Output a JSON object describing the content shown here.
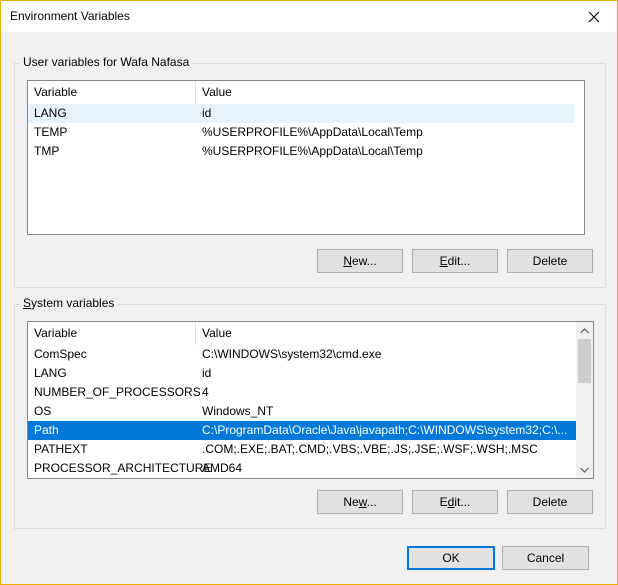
{
  "window": {
    "title": "Environment Variables",
    "accent_color": "#e8b100"
  },
  "user_section": {
    "label": "User variables for Wafa Nafasa",
    "columns": [
      "Variable",
      "Value"
    ],
    "rows": [
      {
        "variable": "LANG",
        "value": "id"
      },
      {
        "variable": "TEMP",
        "value": "%USERPROFILE%\\AppData\\Local\\Temp"
      },
      {
        "variable": "TMP",
        "value": "%USERPROFILE%\\AppData\\Local\\Temp"
      }
    ],
    "buttons": {
      "new": "New...",
      "edit": "Edit...",
      "delete": "Delete"
    }
  },
  "system_section": {
    "label": "System variables",
    "columns": [
      "Variable",
      "Value"
    ],
    "rows": [
      {
        "variable": "ComSpec",
        "value": "C:\\WINDOWS\\system32\\cmd.exe"
      },
      {
        "variable": "LANG",
        "value": "id"
      },
      {
        "variable": "NUMBER_OF_PROCESSORS",
        "value": "4"
      },
      {
        "variable": "OS",
        "value": "Windows_NT"
      },
      {
        "variable": "Path",
        "value": "C:\\ProgramData\\Oracle\\Java\\javapath;C:\\WINDOWS\\system32;C:\\..."
      },
      {
        "variable": "PATHEXT",
        "value": ".COM;.EXE;.BAT;.CMD;.VBS;.VBE;.JS;.JSE;.WSF;.WSH;.MSC"
      },
      {
        "variable": "PROCESSOR_ARCHITECTURE",
        "value": "AMD64"
      }
    ],
    "selected_variable": "Path",
    "buttons": {
      "new": "New...",
      "edit": "Edit...",
      "delete": "Delete"
    }
  },
  "footer": {
    "ok": "OK",
    "cancel": "Cancel"
  },
  "icons": {
    "close": "close-icon",
    "scroll_up": "chevron-up-icon",
    "scroll_down": "chevron-down-icon"
  },
  "colors": {
    "selection": "#0078d7",
    "hover_row": "#e5f3ff"
  }
}
